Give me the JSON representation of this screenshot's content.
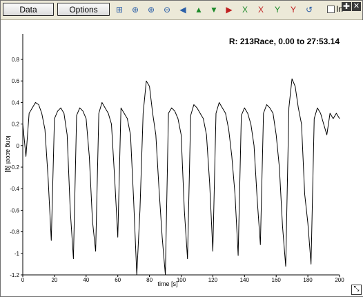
{
  "toolbar": {
    "data_label": "Data",
    "options_label": "Options",
    "icons": [
      "zoom-box-icon",
      "zoom-select-icon",
      "zoom-in-icon",
      "zoom-out-icon",
      "pan-left-icon",
      "pan-up-icon",
      "pan-down-icon",
      "pan-right-icon",
      "x-zoom-in-icon",
      "x-zoom-out-icon",
      "y-zoom-in-icon",
      "y-zoom-out-icon",
      "reset-view-icon"
    ],
    "checkbox_label": "In"
  },
  "chart_data": {
    "type": "line",
    "title": "R:  213Race, 0.00 to 27:53.14",
    "xlabel": "time [s]",
    "ylabel": "long accel [g]",
    "xlim": [
      0,
      200
    ],
    "ylim": [
      -1.2,
      0.8
    ],
    "xticks": [
      0,
      20,
      40,
      60,
      80,
      100,
      120,
      140,
      160,
      180,
      200
    ],
    "yticks": [
      0.8,
      0.6,
      0.4,
      0.2,
      0,
      -0.2,
      -0.4,
      -0.6,
      -0.8,
      -1,
      -1.2
    ],
    "series": [
      {
        "color": "#000000",
        "x": [
          0,
          2,
          4,
          6,
          8,
          10,
          12,
          14,
          16,
          18,
          20,
          22,
          24,
          26,
          28,
          30,
          32,
          34,
          36,
          38,
          40,
          42,
          44,
          46,
          48,
          50,
          52,
          54,
          56,
          58,
          60,
          62,
          64,
          66,
          68,
          70,
          72,
          74,
          76,
          78,
          80,
          82,
          84,
          86,
          88,
          90,
          92,
          94,
          96,
          98,
          100,
          102,
          104,
          106,
          108,
          110,
          112,
          114,
          116,
          118,
          120,
          122,
          124,
          126,
          128,
          130,
          132,
          134,
          136,
          138,
          140,
          142,
          144,
          146,
          148,
          150,
          152,
          154,
          156,
          158,
          160,
          162,
          164,
          166,
          168,
          170,
          172,
          174,
          176,
          178,
          180,
          182,
          184,
          186,
          188,
          190,
          192,
          194,
          196,
          198,
          200
        ],
        "y": [
          0.2,
          -0.1,
          0.3,
          0.35,
          0.4,
          0.38,
          0.3,
          0.15,
          -0.3,
          -0.88,
          0.25,
          0.32,
          0.35,
          0.3,
          0.1,
          -0.6,
          -1.05,
          0.28,
          0.35,
          0.32,
          0.25,
          -0.1,
          -0.7,
          -0.98,
          0.3,
          0.4,
          0.35,
          0.3,
          0.2,
          -0.3,
          -0.85,
          0.35,
          0.3,
          0.25,
          0.1,
          -0.5,
          -1.2,
          -0.6,
          0.3,
          0.6,
          0.55,
          0.3,
          0.1,
          -0.4,
          -0.85,
          -1.2,
          0.3,
          0.35,
          0.32,
          0.25,
          0.1,
          -0.6,
          -1.05,
          0.28,
          0.38,
          0.35,
          0.3,
          0.25,
          0.1,
          -0.35,
          -0.98,
          0.3,
          0.4,
          0.35,
          0.3,
          0.15,
          -0.1,
          -0.45,
          -1.02,
          0.28,
          0.35,
          0.3,
          0.2,
          0.0,
          -0.5,
          -0.92,
          0.3,
          0.38,
          0.35,
          0.3,
          0.1,
          -0.2,
          -0.75,
          -1.12,
          0.35,
          0.62,
          0.55,
          0.35,
          0.2,
          -0.45,
          -0.72,
          -1.1,
          0.25,
          0.35,
          0.3,
          0.2,
          0.1,
          0.3,
          0.25,
          0.3,
          0.25
        ]
      }
    ]
  }
}
